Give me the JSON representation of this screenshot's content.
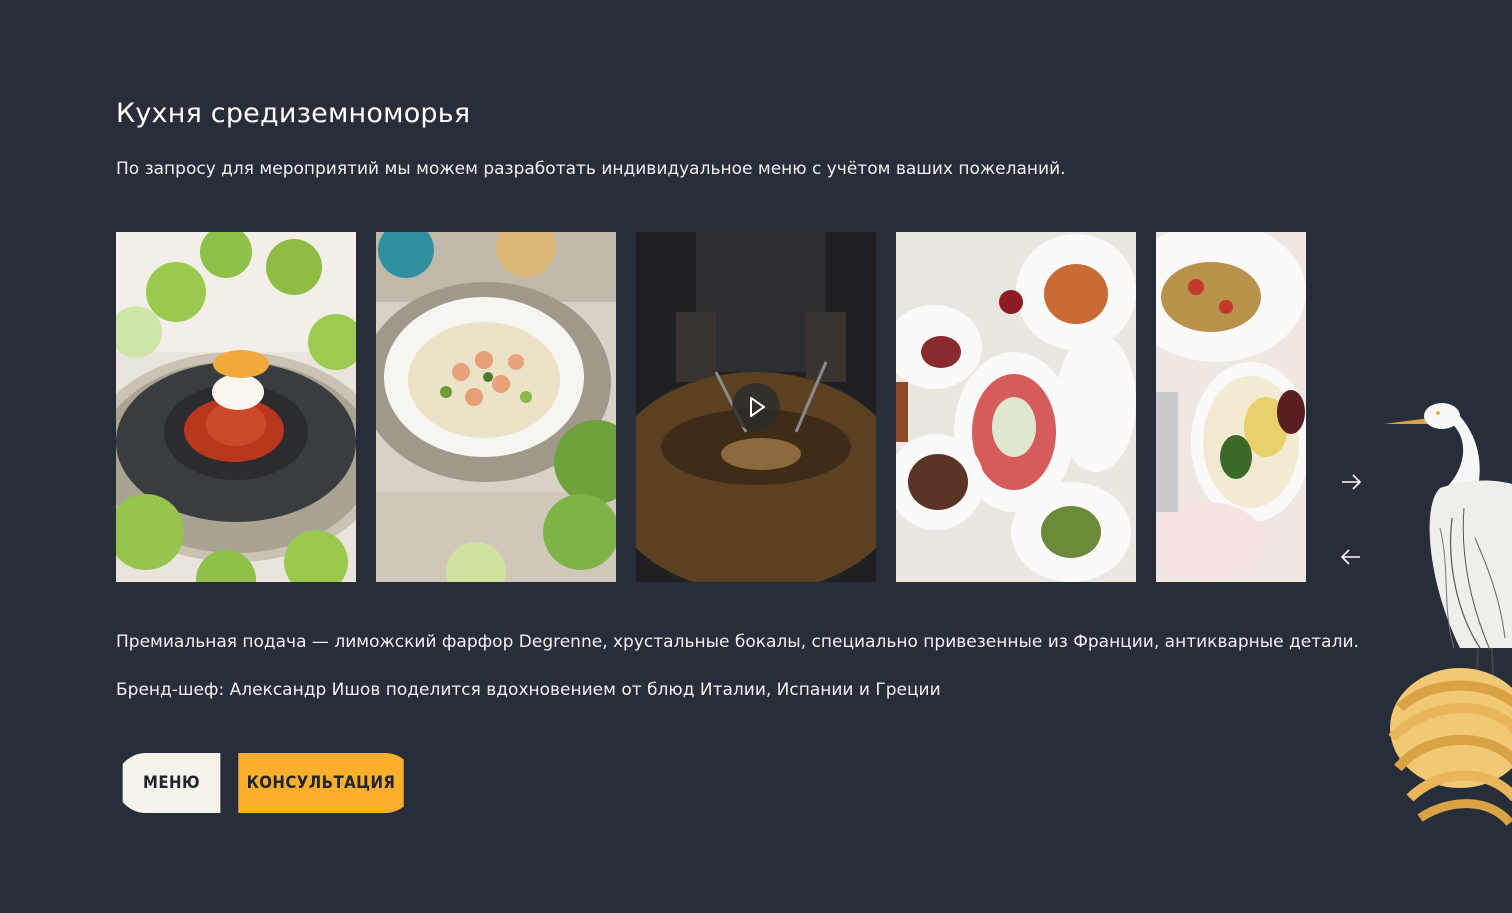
{
  "section": {
    "title": "Кухня средиземноморья",
    "subtitle": "По запросу для мероприятий мы можем разработать индивидуальное меню с учётом ваших пожеланий."
  },
  "gallery": {
    "items": [
      {
        "kind": "photo",
        "subject": "dessert-in-stone-bowl"
      },
      {
        "kind": "photo",
        "subject": "soup-with-shrimp"
      },
      {
        "kind": "video",
        "subject": "pasta-in-cheese-wheel"
      },
      {
        "kind": "photo",
        "subject": "table-overhead-dishes"
      },
      {
        "kind": "photo",
        "subject": "plates-with-salad"
      }
    ],
    "next_icon": "arrow-right-icon",
    "prev_icon": "arrow-left-icon"
  },
  "details": {
    "line1": "Премиальная подача — лиможский фарфор Degrenne, хрустальные бокалы, специально привезенные из Франции, антикварные детали.",
    "line2": "Бренд-шеф: Александр Ишов поделится вдохновением от блюд Италии, Испании и Греции"
  },
  "buttons": {
    "menu_label": "МЕНЮ",
    "consult_label": "КОНСУЛЬТАЦИЯ"
  },
  "colors": {
    "background": "#272d39",
    "accent": "#fbaf2c",
    "light_button": "#f5f3ea"
  }
}
